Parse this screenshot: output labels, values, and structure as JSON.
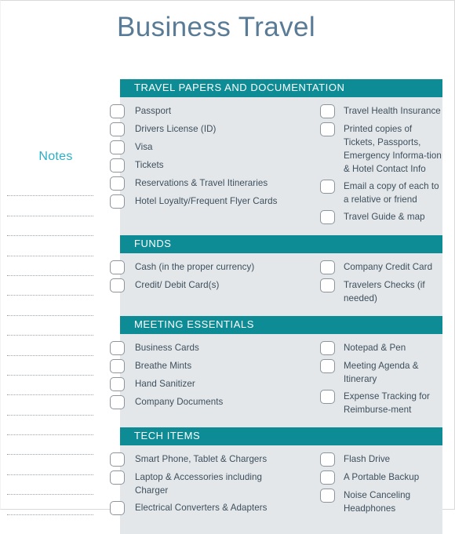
{
  "page": {
    "title": "Business Travel",
    "accent_teal": "#0e8c96",
    "panel_bg": "#e3e7ea",
    "title_color": "#5a7b96",
    "notes_label_color": "#2bafc4",
    "item_text_color": "#3d4f5c"
  },
  "notes": {
    "label": "Notes",
    "line_count": 17
  },
  "sections": [
    {
      "header": "TRAVEL PAPERS AND DOCUMENTATION",
      "left_items": [
        "Passport",
        "Drivers License (ID)",
        "Visa",
        "Tickets",
        "Reservations & Travel Itineraries",
        "Hotel Loyalty/Frequent Flyer Cards"
      ],
      "right_items": [
        "Travel Health Insurance",
        "Printed copies of Tickets, Passports, Emergency Informa-tion & Hotel Contact Info",
        "Email a copy of each to a relative or friend",
        "Travel Guide & map"
      ]
    },
    {
      "header": "FUNDS",
      "left_items": [
        "Cash (in the proper currency)",
        "Credit/ Debit Card(s)"
      ],
      "right_items": [
        "Company Credit Card",
        "Travelers Checks (if needed)"
      ]
    },
    {
      "header": "MEETING ESSENTIALS",
      "left_items": [
        "Business Cards",
        "Breathe Mints",
        "Hand Sanitizer",
        "Company Documents"
      ],
      "right_items": [
        "Notepad & Pen",
        "Meeting Agenda & Itinerary",
        "Expense Tracking for Reimburse-ment"
      ]
    },
    {
      "header": "TECH ITEMS",
      "left_items": [
        "Smart Phone, Tablet & Chargers",
        "Laptop & Accessories including Charger",
        "Electrical Converters & Adapters"
      ],
      "right_items": [
        "Flash Drive",
        "A Portable Backup",
        "Noise Canceling Headphones"
      ]
    }
  ]
}
